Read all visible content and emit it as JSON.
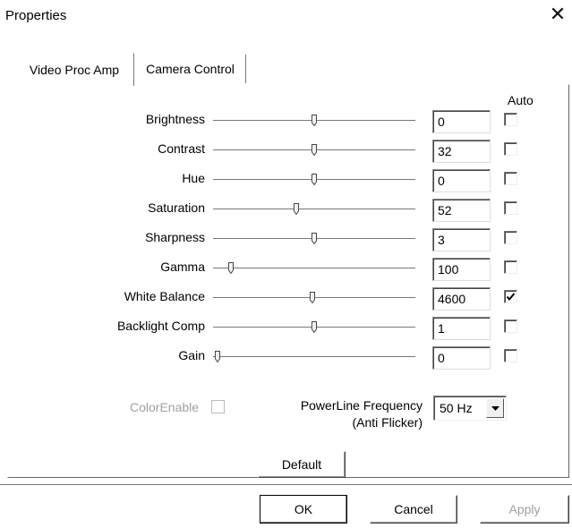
{
  "window": {
    "title": "Properties",
    "close_glyph": "✕"
  },
  "tabs": [
    {
      "label": "Video Proc Amp",
      "active": true
    },
    {
      "label": "Camera Control",
      "active": false
    }
  ],
  "auto_header": "Auto",
  "controls": [
    {
      "label": "Brightness",
      "value": "0",
      "slider_fraction": 0.5,
      "auto": false
    },
    {
      "label": "Contrast",
      "value": "32",
      "slider_fraction": 0.5,
      "auto": false
    },
    {
      "label": "Hue",
      "value": "0",
      "slider_fraction": 0.5,
      "auto": false
    },
    {
      "label": "Saturation",
      "value": "52",
      "slider_fraction": 0.41,
      "auto": false
    },
    {
      "label": "Sharpness",
      "value": "3",
      "slider_fraction": 0.5,
      "auto": false
    },
    {
      "label": "Gamma",
      "value": "100",
      "slider_fraction": 0.09,
      "auto": false
    },
    {
      "label": "White Balance",
      "value": "4600",
      "slider_fraction": 0.49,
      "auto": true
    },
    {
      "label": "Backlight Comp",
      "value": "1",
      "slider_fraction": 0.5,
      "auto": false
    },
    {
      "label": "Gain",
      "value": "0",
      "slider_fraction": 0.02,
      "auto": false
    }
  ],
  "color_enable": {
    "label": "ColorEnable",
    "checked": false,
    "enabled": false
  },
  "powerline": {
    "label_line1": "PowerLine Frequency",
    "label_line2": "(Anti Flicker)",
    "selected": "50 Hz"
  },
  "buttons": {
    "default": "Default",
    "ok": "OK",
    "cancel": "Cancel",
    "apply": "Apply"
  },
  "icons": {
    "close": "close-icon",
    "dropdown": "chevron-down-icon",
    "check": "check-icon"
  }
}
